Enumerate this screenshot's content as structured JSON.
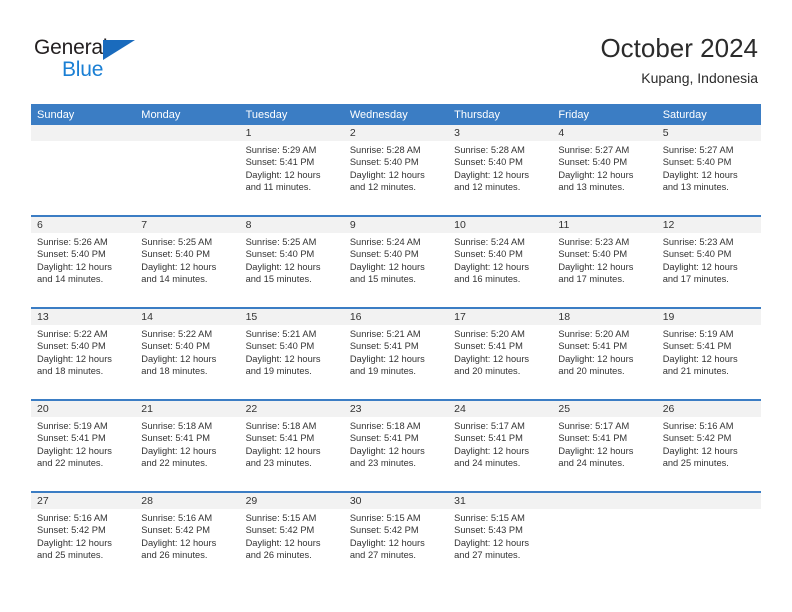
{
  "brand": {
    "name_part1": "General",
    "name_part2": "Blue",
    "accent_color": "#1a7fd4",
    "triangle_color": "#1a6bbd"
  },
  "header": {
    "title": "October 2024",
    "subtitle": "Kupang, Indonesia"
  },
  "calendar": {
    "header_bg": "#3b7dc4",
    "weekday_headers": [
      "Sunday",
      "Monday",
      "Tuesday",
      "Wednesday",
      "Thursday",
      "Friday",
      "Saturday"
    ],
    "weeks": [
      [
        {
          "day": "",
          "empty": true
        },
        {
          "day": "",
          "empty": true
        },
        {
          "day": "1",
          "sunrise": "Sunrise: 5:29 AM",
          "sunset": "Sunset: 5:41 PM",
          "daylight_line1": "Daylight: 12 hours",
          "daylight_line2": "and 11 minutes."
        },
        {
          "day": "2",
          "sunrise": "Sunrise: 5:28 AM",
          "sunset": "Sunset: 5:40 PM",
          "daylight_line1": "Daylight: 12 hours",
          "daylight_line2": "and 12 minutes."
        },
        {
          "day": "3",
          "sunrise": "Sunrise: 5:28 AM",
          "sunset": "Sunset: 5:40 PM",
          "daylight_line1": "Daylight: 12 hours",
          "daylight_line2": "and 12 minutes."
        },
        {
          "day": "4",
          "sunrise": "Sunrise: 5:27 AM",
          "sunset": "Sunset: 5:40 PM",
          "daylight_line1": "Daylight: 12 hours",
          "daylight_line2": "and 13 minutes."
        },
        {
          "day": "5",
          "sunrise": "Sunrise: 5:27 AM",
          "sunset": "Sunset: 5:40 PM",
          "daylight_line1": "Daylight: 12 hours",
          "daylight_line2": "and 13 minutes."
        }
      ],
      [
        {
          "day": "6",
          "sunrise": "Sunrise: 5:26 AM",
          "sunset": "Sunset: 5:40 PM",
          "daylight_line1": "Daylight: 12 hours",
          "daylight_line2": "and 14 minutes."
        },
        {
          "day": "7",
          "sunrise": "Sunrise: 5:25 AM",
          "sunset": "Sunset: 5:40 PM",
          "daylight_line1": "Daylight: 12 hours",
          "daylight_line2": "and 14 minutes."
        },
        {
          "day": "8",
          "sunrise": "Sunrise: 5:25 AM",
          "sunset": "Sunset: 5:40 PM",
          "daylight_line1": "Daylight: 12 hours",
          "daylight_line2": "and 15 minutes."
        },
        {
          "day": "9",
          "sunrise": "Sunrise: 5:24 AM",
          "sunset": "Sunset: 5:40 PM",
          "daylight_line1": "Daylight: 12 hours",
          "daylight_line2": "and 15 minutes."
        },
        {
          "day": "10",
          "sunrise": "Sunrise: 5:24 AM",
          "sunset": "Sunset: 5:40 PM",
          "daylight_line1": "Daylight: 12 hours",
          "daylight_line2": "and 16 minutes."
        },
        {
          "day": "11",
          "sunrise": "Sunrise: 5:23 AM",
          "sunset": "Sunset: 5:40 PM",
          "daylight_line1": "Daylight: 12 hours",
          "daylight_line2": "and 17 minutes."
        },
        {
          "day": "12",
          "sunrise": "Sunrise: 5:23 AM",
          "sunset": "Sunset: 5:40 PM",
          "daylight_line1": "Daylight: 12 hours",
          "daylight_line2": "and 17 minutes."
        }
      ],
      [
        {
          "day": "13",
          "sunrise": "Sunrise: 5:22 AM",
          "sunset": "Sunset: 5:40 PM",
          "daylight_line1": "Daylight: 12 hours",
          "daylight_line2": "and 18 minutes."
        },
        {
          "day": "14",
          "sunrise": "Sunrise: 5:22 AM",
          "sunset": "Sunset: 5:40 PM",
          "daylight_line1": "Daylight: 12 hours",
          "daylight_line2": "and 18 minutes."
        },
        {
          "day": "15",
          "sunrise": "Sunrise: 5:21 AM",
          "sunset": "Sunset: 5:40 PM",
          "daylight_line1": "Daylight: 12 hours",
          "daylight_line2": "and 19 minutes."
        },
        {
          "day": "16",
          "sunrise": "Sunrise: 5:21 AM",
          "sunset": "Sunset: 5:41 PM",
          "daylight_line1": "Daylight: 12 hours",
          "daylight_line2": "and 19 minutes."
        },
        {
          "day": "17",
          "sunrise": "Sunrise: 5:20 AM",
          "sunset": "Sunset: 5:41 PM",
          "daylight_line1": "Daylight: 12 hours",
          "daylight_line2": "and 20 minutes."
        },
        {
          "day": "18",
          "sunrise": "Sunrise: 5:20 AM",
          "sunset": "Sunset: 5:41 PM",
          "daylight_line1": "Daylight: 12 hours",
          "daylight_line2": "and 20 minutes."
        },
        {
          "day": "19",
          "sunrise": "Sunrise: 5:19 AM",
          "sunset": "Sunset: 5:41 PM",
          "daylight_line1": "Daylight: 12 hours",
          "daylight_line2": "and 21 minutes."
        }
      ],
      [
        {
          "day": "20",
          "sunrise": "Sunrise: 5:19 AM",
          "sunset": "Sunset: 5:41 PM",
          "daylight_line1": "Daylight: 12 hours",
          "daylight_line2": "and 22 minutes."
        },
        {
          "day": "21",
          "sunrise": "Sunrise: 5:18 AM",
          "sunset": "Sunset: 5:41 PM",
          "daylight_line1": "Daylight: 12 hours",
          "daylight_line2": "and 22 minutes."
        },
        {
          "day": "22",
          "sunrise": "Sunrise: 5:18 AM",
          "sunset": "Sunset: 5:41 PM",
          "daylight_line1": "Daylight: 12 hours",
          "daylight_line2": "and 23 minutes."
        },
        {
          "day": "23",
          "sunrise": "Sunrise: 5:18 AM",
          "sunset": "Sunset: 5:41 PM",
          "daylight_line1": "Daylight: 12 hours",
          "daylight_line2": "and 23 minutes."
        },
        {
          "day": "24",
          "sunrise": "Sunrise: 5:17 AM",
          "sunset": "Sunset: 5:41 PM",
          "daylight_line1": "Daylight: 12 hours",
          "daylight_line2": "and 24 minutes."
        },
        {
          "day": "25",
          "sunrise": "Sunrise: 5:17 AM",
          "sunset": "Sunset: 5:41 PM",
          "daylight_line1": "Daylight: 12 hours",
          "daylight_line2": "and 24 minutes."
        },
        {
          "day": "26",
          "sunrise": "Sunrise: 5:16 AM",
          "sunset": "Sunset: 5:42 PM",
          "daylight_line1": "Daylight: 12 hours",
          "daylight_line2": "and 25 minutes."
        }
      ],
      [
        {
          "day": "27",
          "sunrise": "Sunrise: 5:16 AM",
          "sunset": "Sunset: 5:42 PM",
          "daylight_line1": "Daylight: 12 hours",
          "daylight_line2": "and 25 minutes."
        },
        {
          "day": "28",
          "sunrise": "Sunrise: 5:16 AM",
          "sunset": "Sunset: 5:42 PM",
          "daylight_line1": "Daylight: 12 hours",
          "daylight_line2": "and 26 minutes."
        },
        {
          "day": "29",
          "sunrise": "Sunrise: 5:15 AM",
          "sunset": "Sunset: 5:42 PM",
          "daylight_line1": "Daylight: 12 hours",
          "daylight_line2": "and 26 minutes."
        },
        {
          "day": "30",
          "sunrise": "Sunrise: 5:15 AM",
          "sunset": "Sunset: 5:42 PM",
          "daylight_line1": "Daylight: 12 hours",
          "daylight_line2": "and 27 minutes."
        },
        {
          "day": "31",
          "sunrise": "Sunrise: 5:15 AM",
          "sunset": "Sunset: 5:43 PM",
          "daylight_line1": "Daylight: 12 hours",
          "daylight_line2": "and 27 minutes."
        },
        {
          "day": "",
          "empty": true
        },
        {
          "day": "",
          "empty": true
        }
      ]
    ]
  }
}
